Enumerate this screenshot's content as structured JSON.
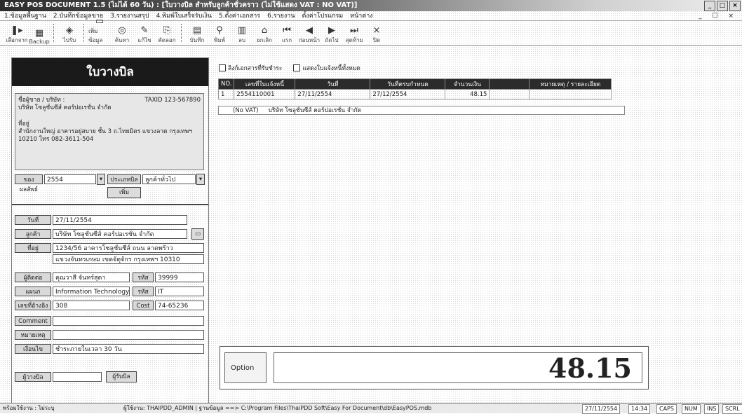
{
  "window": {
    "title": "EASY POS DOCUMENT 1.5 (ไม่ได้ 60 วัน) : [ใบวางบิล สำหรับลูกค้าชั่วคราว (ไม่ใช้แสดง VAT : NO VAT)]",
    "min_label": "_",
    "max_label": "□",
    "close_label": "×"
  },
  "menu": {
    "items": [
      "1.ข้อมูลพื้นฐาน",
      "2.บันทึกข้อมูลขาย",
      "3.รายงานสรุป",
      "4.พิมพ์ใบเสร็จรับเงิน",
      "5.ตั้งค่าเอกสาร",
      "6.รายงาน",
      "ตั้งค่าโปรแกรม",
      "หน้าต่าง"
    ],
    "window_controls": "_ ☐ ×"
  },
  "toolbar": {
    "groups": [
      [
        {
          "icon": "❚▸",
          "label": "เลือกจาก"
        },
        {
          "icon": "▦",
          "label": "Backup"
        }
      ],
      [
        {
          "icon": "◈",
          "label": "ไปรับ"
        }
      ],
      [
        {
          "icon": "▭",
          "label": "เพิ่มข้อมูล"
        },
        {
          "icon": "◎",
          "label": "ค้นหา"
        },
        {
          "icon": "✎",
          "label": "แก้ไข"
        },
        {
          "icon": "⎘",
          "label": "คัดลอก"
        }
      ],
      [
        {
          "icon": "▤",
          "label": "บันทึก"
        },
        {
          "icon": "⚲",
          "label": "พิมพ์"
        },
        {
          "icon": "▥",
          "label": "ลบ"
        },
        {
          "icon": "⌂",
          "label": "ยกเลิก"
        },
        {
          "icon": "⏮",
          "label": "แรก"
        },
        {
          "icon": "◀",
          "label": "ก่อนหน้า"
        },
        {
          "icon": "▶",
          "label": "ถัดไป"
        },
        {
          "icon": "⏭",
          "label": "สุดท้าย"
        },
        {
          "icon": "×",
          "label": "ปิด"
        }
      ]
    ]
  },
  "form": {
    "header": "ใบวางบิล",
    "company": {
      "name_label": "ชื่อผู้ขาย / บริษัท :",
      "taxid_label": "TAXID",
      "taxid": "123-567890",
      "name": "บริษัท โซลูชั่นซีส์ คอร์ปอเรชั่น จำกัด",
      "addr_label": "ที่อยู่",
      "address1": "สำนักงานใหญ่ อาคารอยู่สบาย ชั้น 3 ถ.ไทยมิตร แขวงลาด กรุงเทพฯ",
      "address2": "10210 โทร 082-3611-504"
    },
    "year_label": "ของผลลัพธ์",
    "year_value": "2554",
    "doc_type_label": "ประเภทบิล",
    "doc_type_value": "ลูกค้าทั่วไป",
    "add_label": "เพิ่ม",
    "date_label": "วันที่",
    "date_value": "27/11/2554",
    "customer_label": "ลูกค้า",
    "customer_value": "บริษัท โซลูชั่นซีส์ คอร์ปอเรชั่น จำกัด",
    "address_label": "ที่อยู่",
    "address1": "1234/56 อาคารโซลูชั่นซีส์ ถนน ลาดพร้าว",
    "address2": "แขวงจันทรเกษม เขตจัตุจักร กรุงเทพฯ 10310",
    "contact_label": "ผู้ติดต่อ",
    "contact_value": "คุณวาสี จันทร์สุดา",
    "code_label": "รหัส",
    "code_value": "39999",
    "dept_label": "แผนก",
    "dept_value": "Information Technology",
    "dept_code_label": "รหัส",
    "dept_code_value": "IT",
    "ref_label": "เลขที่อ้างอิง",
    "ref_value": "308",
    "cost_label": "Cost",
    "cost_value": "74-65236",
    "comment_label": "Comment",
    "comment_value": "",
    "note_label": "หมายเหตุ",
    "note_value": "",
    "condition_label": "เงื่อนไข",
    "condition_value": "ชำระภายในเวลา 30 วัน",
    "sign_label": "ผู้วางบิล",
    "sign_btn_label": "ผู้รับบิล"
  },
  "checks": [
    {
      "label": "ลิงก์เอกสารที่รับชำระ",
      "checked": false
    },
    {
      "label": "แสดงใบแจ้งหนี้ทั้งหมด",
      "checked": false
    }
  ],
  "grid": {
    "headers": [
      "NO.",
      "เลขที่ใบแจ้งหนี้",
      "วันที่",
      "วันที่ครบกำหนด",
      "จำนวนเงิน",
      "",
      "หมายเหตุ / รายละเอียด"
    ],
    "rows": [
      [
        "1",
        "2554110001",
        "27/11/2554",
        "27/12/2554",
        "48.15",
        "",
        ""
      ]
    ],
    "sub_label": "(No VAT)",
    "sub_value": "บริษัท โซลูชั่นซีส์ คอร์ปอเรชั่น จำกัด"
  },
  "total": {
    "option_label": "Option",
    "amount": "48.15"
  },
  "status": {
    "left": "พร้อมใช้งาน : ไม่ระบุ",
    "path": "ผู้ใช้งาน: THAIPDD_ADMIN | ฐานข้อมูล ==> C:\\Program Files\\ThaiPDD Soft\\Easy For Document\\db\\EasyPOS.mdb",
    "date": "27/11/2554",
    "time": "14:34",
    "caps": "CAPS",
    "num": "NUM",
    "ins": "INS",
    "scrl": "SCRL"
  }
}
